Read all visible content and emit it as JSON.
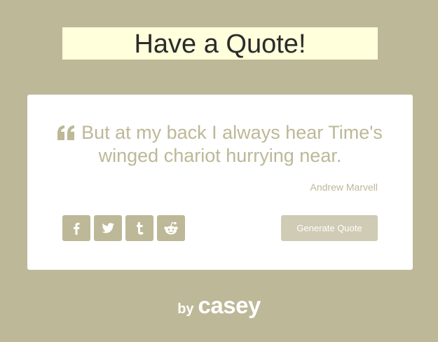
{
  "header": {
    "title": "Have a Quote!"
  },
  "quote": {
    "text": "But at my back I always hear Time's winged chariot hurrying near.",
    "author": "Andrew Marvell",
    "quote_icon": "quote-left-icon"
  },
  "share": {
    "buttons": [
      {
        "icon": "facebook-icon"
      },
      {
        "icon": "twitter-icon"
      },
      {
        "icon": "tumblr-icon"
      },
      {
        "icon": "reddit-icon"
      }
    ]
  },
  "actions": {
    "generate_label": "Generate Quote"
  },
  "footer": {
    "by_label": "by",
    "name": "casey"
  },
  "colors": {
    "background": "#bdb897",
    "title_bg": "#ffffdc",
    "card_bg": "#ffffff",
    "accent": "#bdb897",
    "button_disabled": "#cfcbb4"
  }
}
